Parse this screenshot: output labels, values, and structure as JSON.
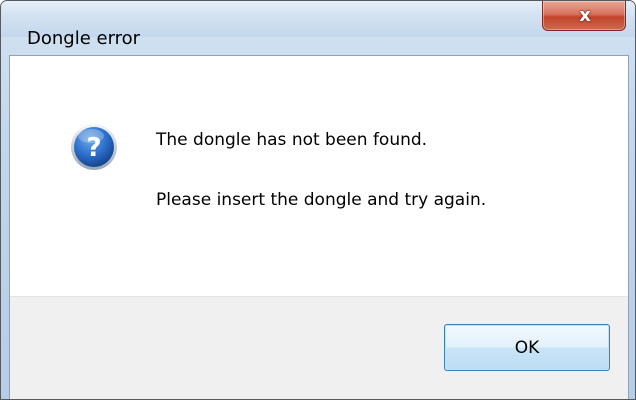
{
  "window": {
    "title": "Dongle error",
    "close_glyph": "x"
  },
  "dialog": {
    "icon": "question-icon",
    "message_line1": "The dongle has not been found.",
    "message_line2": "Please insert the dongle and try again.",
    "ok_label": "OK"
  },
  "colors": {
    "frame": "#c2d6ec",
    "close_button": "#c2432c",
    "icon_blue": "#1f5fb4",
    "button_bar": "#f0f0f0",
    "ok_border": "#3c7fb1"
  }
}
